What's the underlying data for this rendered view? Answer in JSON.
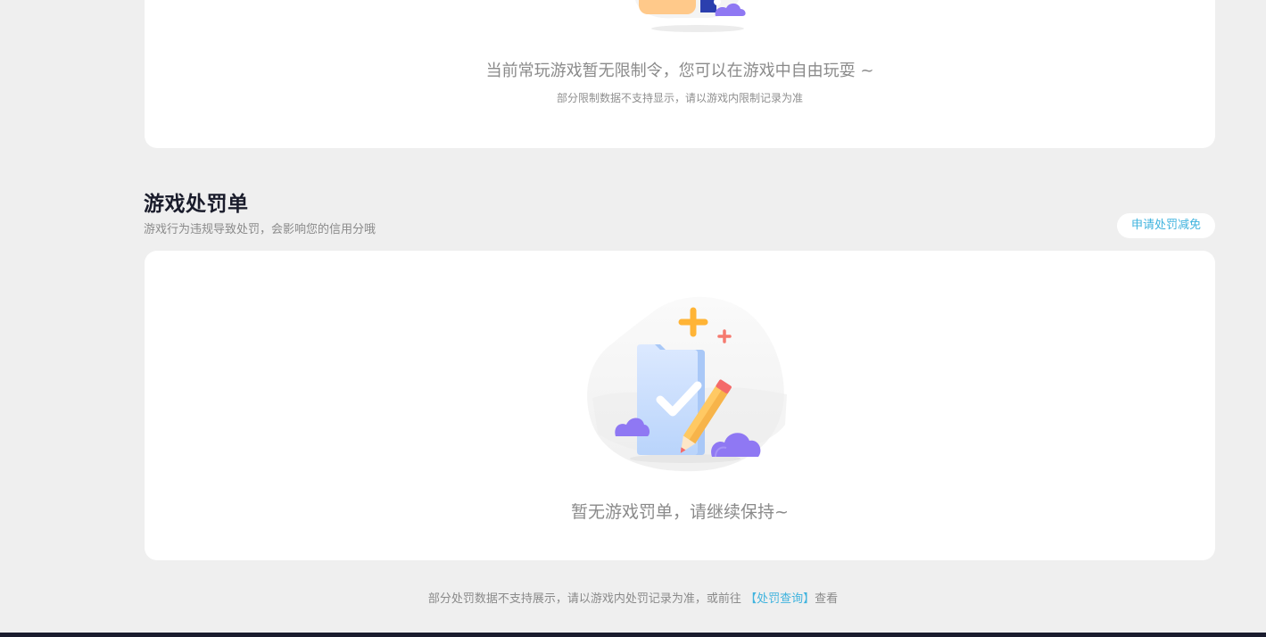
{
  "restriction_card": {
    "message": "当前常玩游戏暂无限制令，您可以在游戏中自由玩耍 ~",
    "note": "部分限制数据不支持显示，请以游戏内限制记录为准"
  },
  "penalty_section": {
    "title": "游戏处罚单",
    "subtitle": "游戏行为违规导致处罚，会影响您的信用分哦",
    "appeal_button_label": "申请处罚减免",
    "empty_message": "暂无游戏罚单，请继续保持~"
  },
  "footer": {
    "note_prefix": "部分处罚数据不支持展示，请以游戏内处罚记录为准，或前往",
    "link_label": "【处罚查询】",
    "note_suffix": "查看"
  },
  "colors": {
    "accent": "#3fb3de",
    "background": "#efefef",
    "card": "#ffffff",
    "title": "#1a1c2b",
    "muted_text": "#8a8a8a"
  }
}
